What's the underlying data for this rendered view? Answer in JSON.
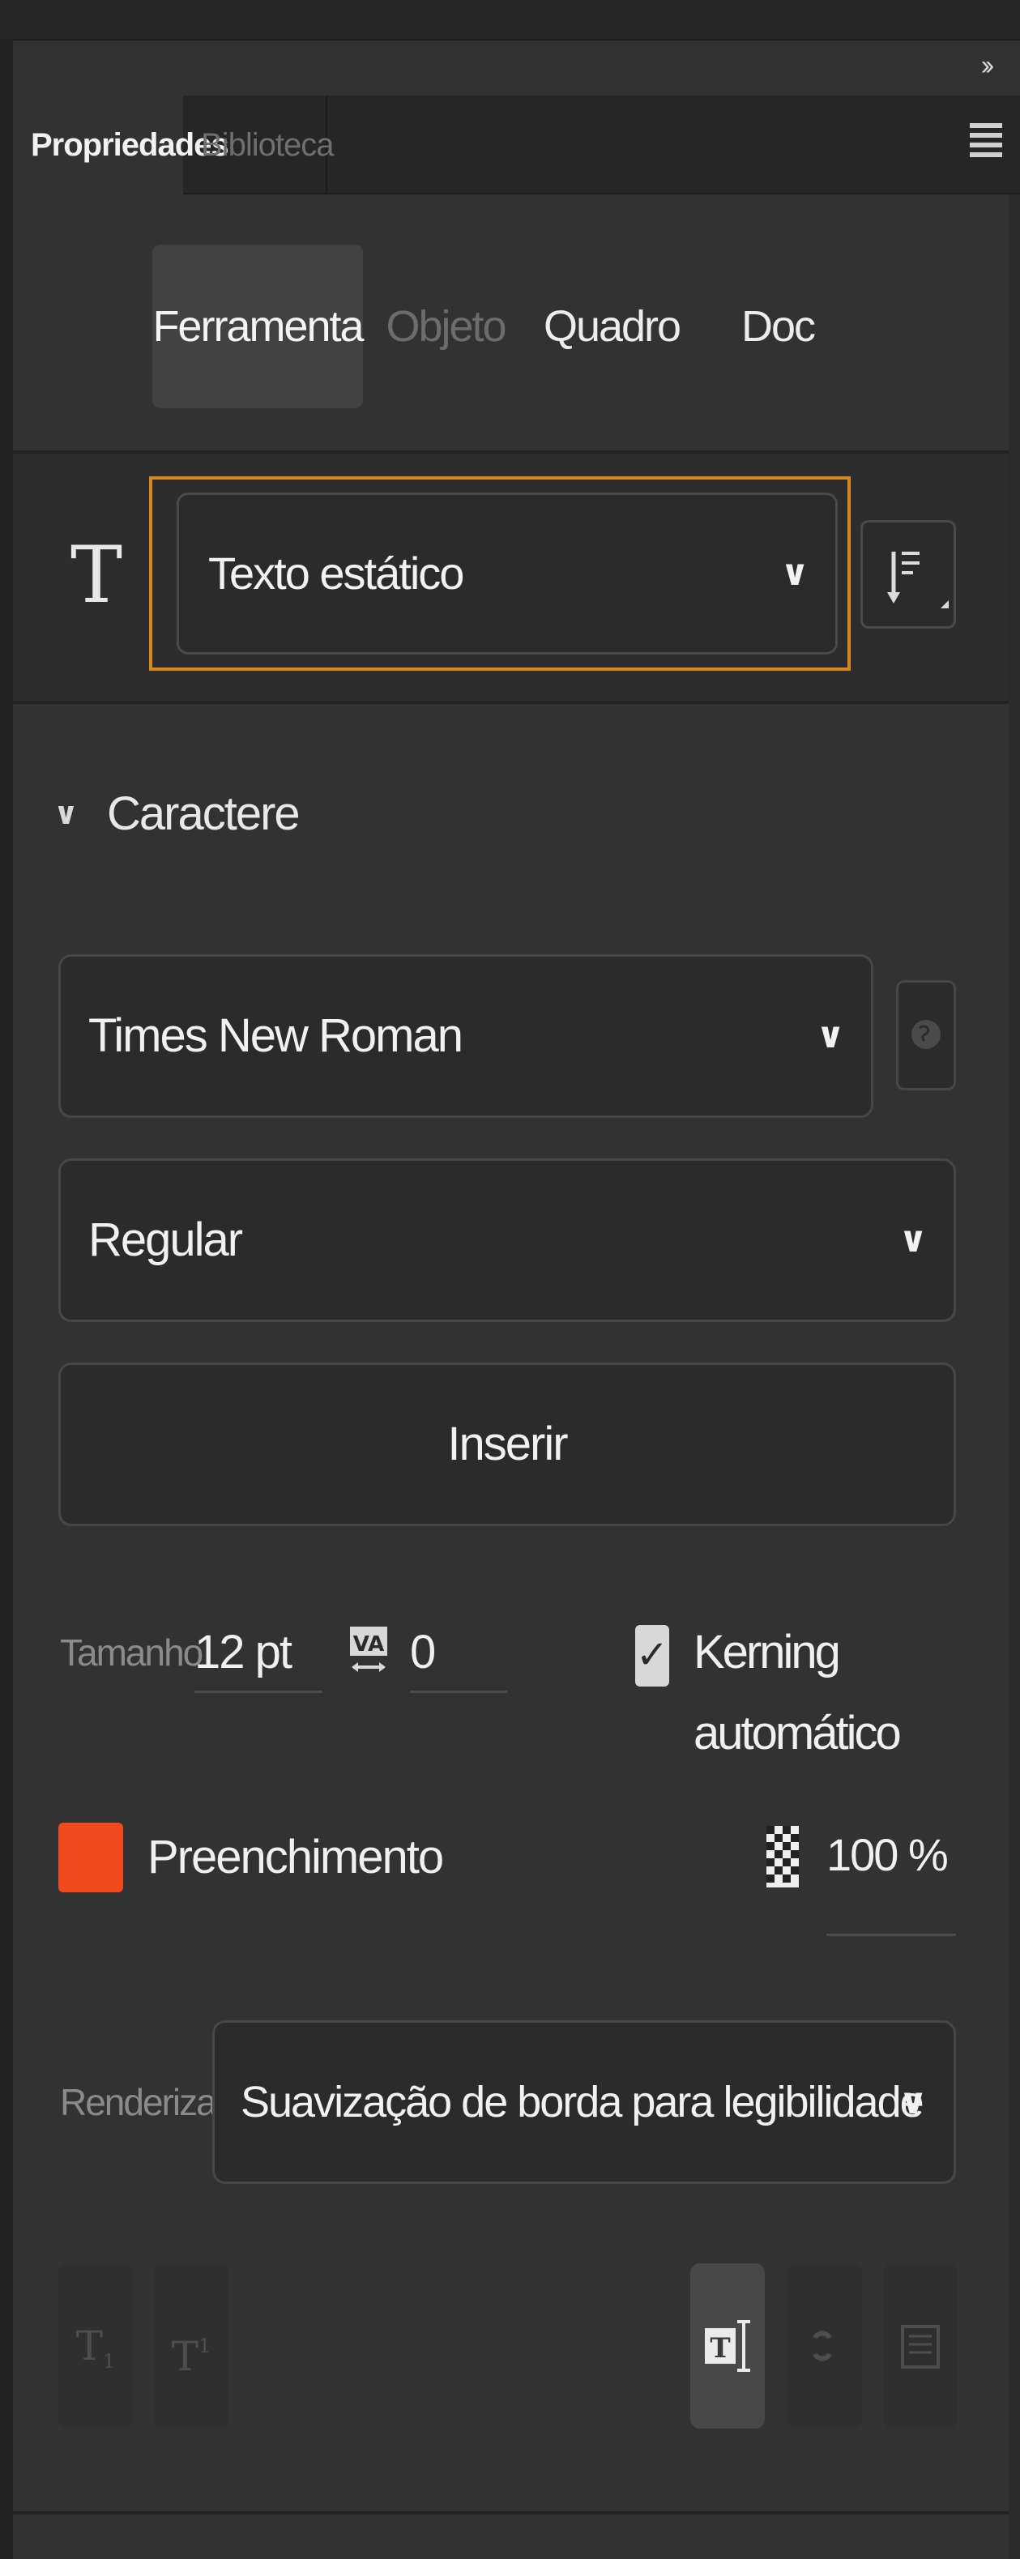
{
  "header": {
    "collapse_icon": "double-chevron-right-icon"
  },
  "tabs": [
    {
      "label": "Propriedades",
      "active": true
    },
    {
      "label": "Biblioteca",
      "active": false
    }
  ],
  "panel_menu_icon": "hamburger-icon",
  "segments": [
    {
      "label": "Ferramenta",
      "active": true
    },
    {
      "label": "Objeto",
      "enabled": false
    },
    {
      "label": "Quadro"
    },
    {
      "label": "Doc"
    }
  ],
  "text_type": {
    "icon": "text-tool-icon",
    "selected": "Texto estático",
    "highlight_color": "#d5891c"
  },
  "orientation_icon": "text-orientation-icon",
  "character": {
    "section_title": "Caractere",
    "font_family": "Times New Roman",
    "font_style": "Regular",
    "insert_label": "Inserir",
    "size_label": "Tamanho",
    "size_value": "12 pt",
    "tracking_value": "0",
    "kerning_label": "Kerning automático",
    "kerning_checked": true,
    "fill_label": "Preenchimento",
    "fill_color": "#f14a1e",
    "alpha_value": "100 %",
    "render_label": "Renderizar",
    "render_value": "Suavização de borda para legibilidade"
  }
}
